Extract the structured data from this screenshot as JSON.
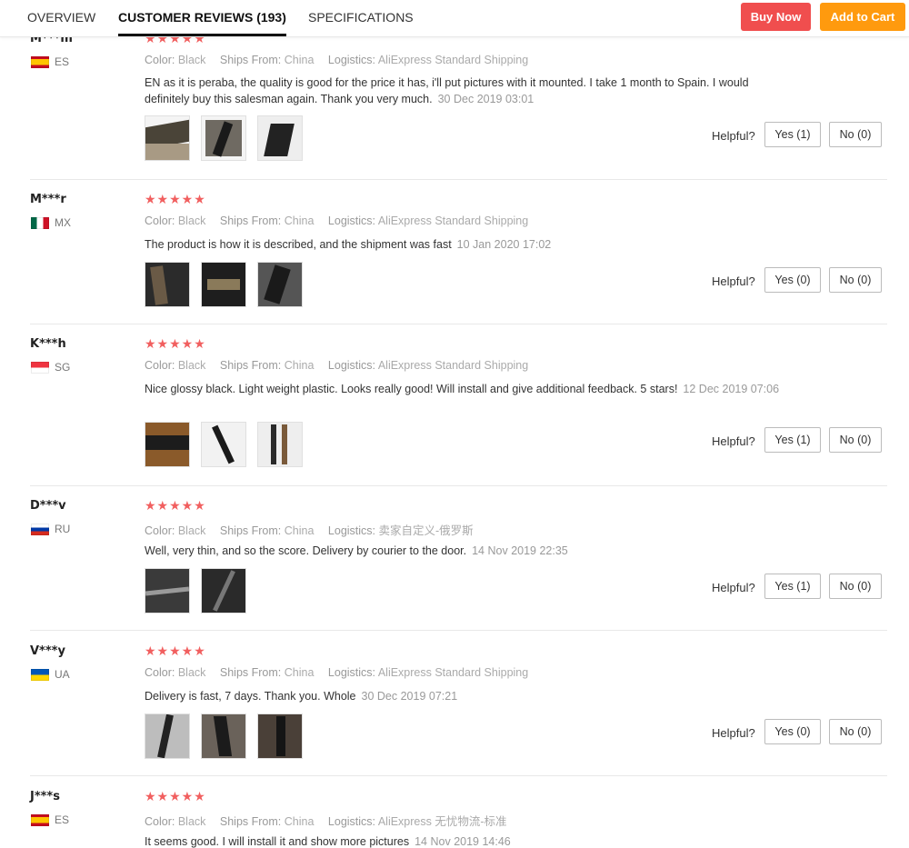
{
  "tabs": {
    "overview": "OVERVIEW",
    "reviews": "CUSTOMER REVIEWS (193)",
    "specs": "SPECIFICATIONS"
  },
  "actions": {
    "buy_now": "Buy Now",
    "add_to_cart": "Add to Cart"
  },
  "labels": {
    "color": "Color:",
    "ships_from": "Ships From:",
    "logistics": "Logistics:",
    "helpful": "Helpful?"
  },
  "stars_glyph": "★★★★★",
  "reviews": [
    {
      "user": "M***m",
      "country": "ES",
      "flag": "es",
      "rating": 5,
      "color": "Black",
      "ships_from": "China",
      "logistics": "AliExpress Standard Shipping",
      "text": "EN as it is peraba, the quality is good for the price it has, i'll put pictures with it mounted. I take 1 month to Spain. I would definitely buy this salesman again. Thank you very much.",
      "date": "30 Dec 2019 03:01",
      "yes": "Yes (1)",
      "no": "No (0)"
    },
    {
      "user": "M***r",
      "country": "MX",
      "flag": "mx",
      "rating": 5,
      "color": "Black",
      "ships_from": "China",
      "logistics": "AliExpress Standard Shipping",
      "text": "The product is how it is described, and the shipment was fast",
      "date": "10 Jan 2020 17:02",
      "yes": "Yes (0)",
      "no": "No (0)"
    },
    {
      "user": "K***h",
      "country": "SG",
      "flag": "sg",
      "rating": 5,
      "color": "Black",
      "ships_from": "China",
      "logistics": "AliExpress Standard Shipping",
      "text": "Nice glossy black. Light weight plastic. Looks really good! Will install and give additional feedback. 5 stars!",
      "date": "12 Dec 2019 07:06",
      "yes": "Yes (1)",
      "no": "No (0)"
    },
    {
      "user": "D***v",
      "country": "RU",
      "flag": "ru",
      "rating": 5,
      "color": "Black",
      "ships_from": "China",
      "logistics": "卖家自定义-俄罗斯",
      "text": "Well, very thin, and so the score. Delivery by courier to the door.",
      "date": "14 Nov 2019 22:35",
      "yes": "Yes (1)",
      "no": "No (0)"
    },
    {
      "user": "V***y",
      "country": "UA",
      "flag": "ua",
      "rating": 5,
      "color": "Black",
      "ships_from": "China",
      "logistics": "AliExpress Standard Shipping",
      "text": "Delivery is fast, 7 days. Thank you. Whole",
      "date": "30 Dec 2019 07:21",
      "yes": "Yes (0)",
      "no": "No (0)"
    },
    {
      "user": "J***s",
      "country": "ES",
      "flag": "es",
      "rating": 5,
      "color": "Black",
      "ships_from": "China",
      "logistics": "AliExpress 无忧物流-标准",
      "text": "It seems good. I will install it and show more pictures",
      "date": "14 Nov 2019 14:46"
    }
  ],
  "colors": {
    "star": "#f15f5f",
    "buy_now": "#f04e4e",
    "add_to_cart": "#ff9a0e"
  }
}
